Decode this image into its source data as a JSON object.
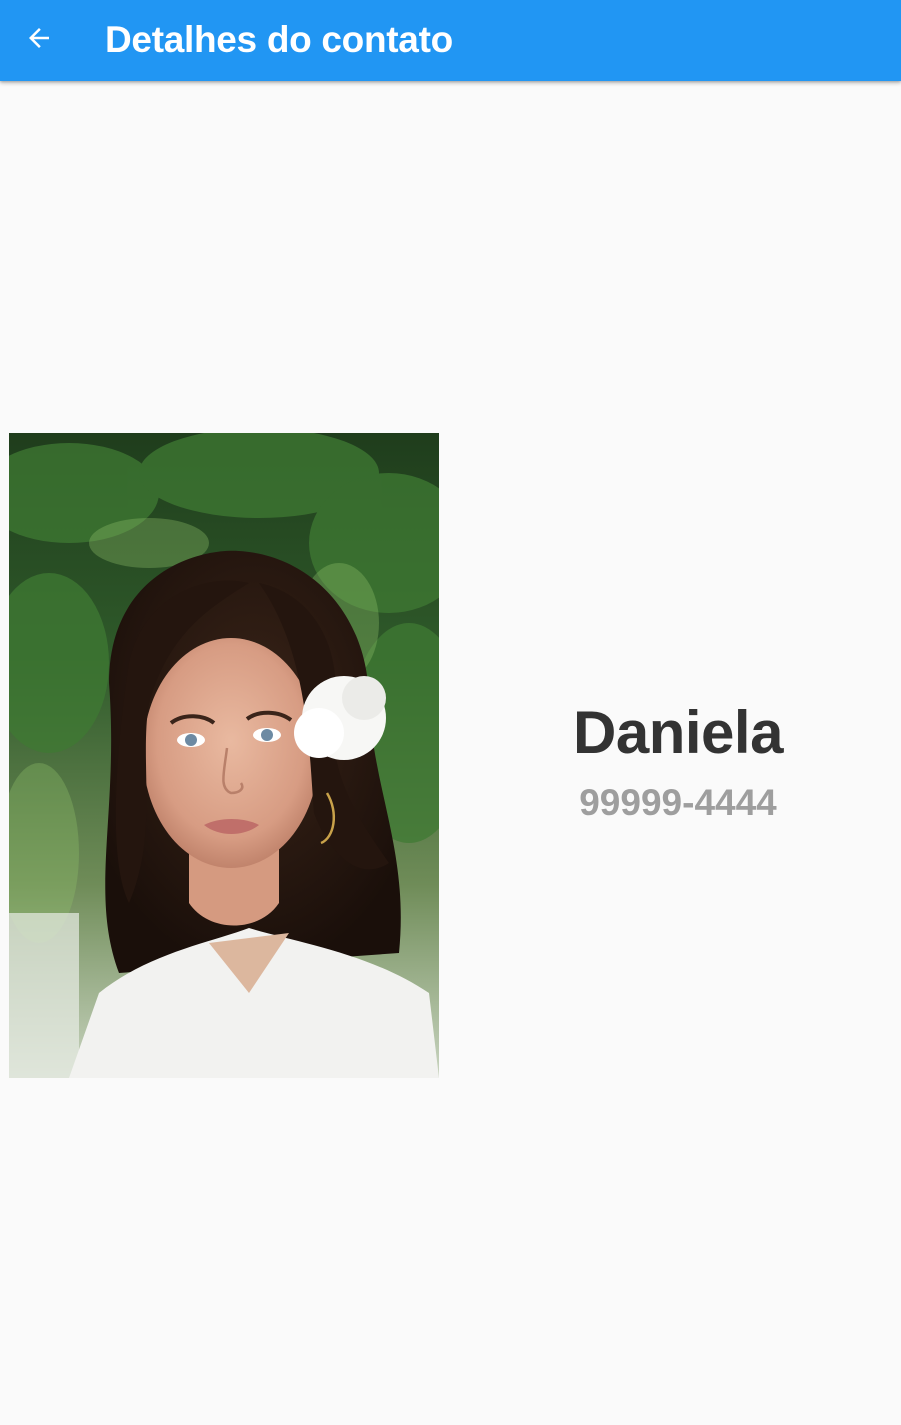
{
  "app_bar": {
    "title": "Detalhes do contato",
    "back_icon": "arrow-back-icon",
    "color": "#2196f3",
    "title_color": "#ffffff"
  },
  "contact": {
    "name": "Daniela",
    "phone": "99999-4444",
    "photo": "contact-photo"
  },
  "colors": {
    "background": "#fafafa",
    "name_text": "#333333",
    "phone_text": "#9e9e9e"
  }
}
